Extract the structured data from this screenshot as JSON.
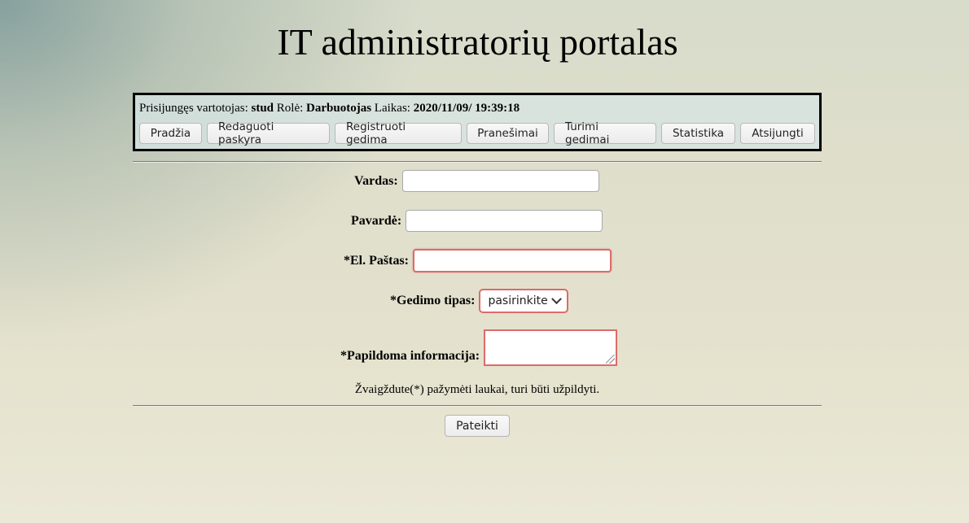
{
  "page": {
    "title": "IT administratorių portalas"
  },
  "user_bar": {
    "logged_in_label": "Prisijungęs vartotojas:",
    "username": "stud",
    "role_label": "Rolė:",
    "role": "Darbuotojas",
    "time_label": "Laikas:",
    "time": "2020/11/09/ 19:39:18"
  },
  "nav": {
    "items": [
      {
        "label": "Pradžia"
      },
      {
        "label": "Redaguoti paskyra"
      },
      {
        "label": "Registruoti gedima"
      },
      {
        "label": "Pranešimai"
      },
      {
        "label": "Turimi gedimai"
      },
      {
        "label": "Statistika"
      },
      {
        "label": "Atsijungti"
      }
    ]
  },
  "form": {
    "first_name": {
      "label": "Vardas:",
      "value": ""
    },
    "last_name": {
      "label": "Pavardė:",
      "value": ""
    },
    "email": {
      "label": "*El. Paštas:",
      "value": ""
    },
    "fault_type": {
      "label": "*Gedimo tipas:",
      "selected": "pasirinkite"
    },
    "extra_info": {
      "label": "*Papildoma informacija:",
      "value": ""
    },
    "required_note": "Žvaigždute(*) pažymėti laukai, turi būti užpildyti.",
    "submit_label": "Pateikti"
  },
  "colors": {
    "required_border": "#dc6b6b",
    "nav_box_border": "#000000"
  }
}
